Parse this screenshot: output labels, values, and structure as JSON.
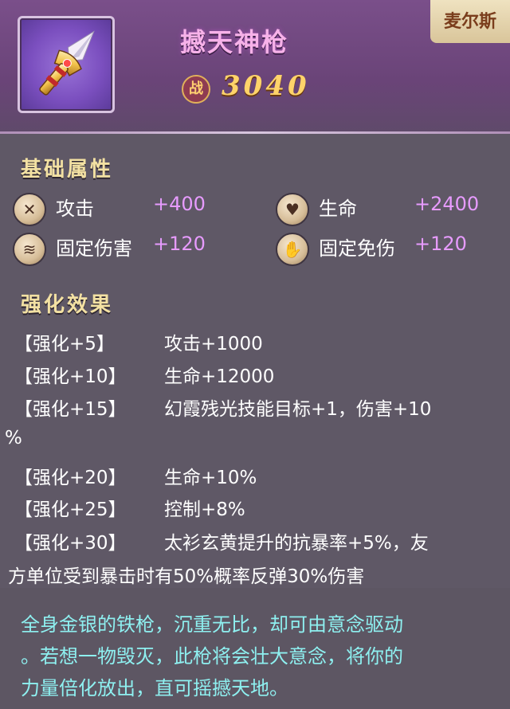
{
  "header": {
    "item_name": "撼天神枪",
    "power_badge": "战",
    "power_value": "3040",
    "character_tag": "麦尔斯"
  },
  "icons": {
    "weapon": "golden-spear-icon",
    "attack": "crossed-swords-icon",
    "hp": "heart-icon",
    "fixed_damage": "claw-slash-icon",
    "fixed_reduction": "open-palm-icon"
  },
  "base_attributes": {
    "title": "基础属性",
    "stats": [
      {
        "label": "攻击",
        "value": "+400"
      },
      {
        "label": "生命",
        "value": "+2400"
      },
      {
        "label": "固定伤害",
        "value": "+120"
      },
      {
        "label": "固定免伤",
        "value": "+120"
      }
    ]
  },
  "enhancement": {
    "title": "强化效果",
    "rows": [
      {
        "level": "【强化+5】",
        "effect": "攻击+1000"
      },
      {
        "level": "【强化+10】",
        "effect": "生命+12000"
      },
      {
        "level": "【强化+15】",
        "effect": "幻霞残光技能目标+1，伤害+10"
      },
      {
        "level": "",
        "effect": "%"
      },
      {
        "level": "【强化+20】",
        "effect": "生命+10%"
      },
      {
        "level": "【强化+25】",
        "effect": "控制+8%"
      },
      {
        "level": "【强化+30】",
        "effect": "太衫玄黄提升的抗暴率+5%，友"
      },
      {
        "level": "",
        "effect": "方单位受到暴击时有50%概率反弹30%伤害"
      }
    ]
  },
  "lore": [
    "全身金银的铁枪，沉重无比，却可由意念驱动",
    "。若想一物毁灭，此枪将会壮大意念，将你的",
    "力量倍化放出，直可摇撼天地。"
  ],
  "colors": {
    "header_bg": "#6a4478",
    "name": "#f7b2e9",
    "power": "#ffd36a",
    "section_title": "#f3e1a3",
    "stat_value": "#e79bff",
    "lore_text": "#8ef0f0"
  }
}
